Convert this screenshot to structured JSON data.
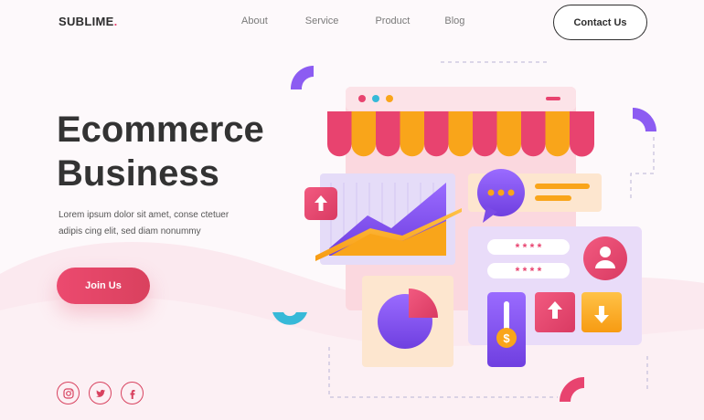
{
  "brand": {
    "name": "SUBLIME",
    "dot": ".",
    "accent": "#e8436f"
  },
  "nav": {
    "items": [
      "About",
      "Service",
      "Product",
      "Blog"
    ]
  },
  "header": {
    "contact_label": "Contact Us"
  },
  "hero": {
    "title_line1": "Ecommerce",
    "title_line2": "Business",
    "desc_line1": "Lorem ipsum dolor sit amet, conse ctetuer",
    "desc_line2": "adipis cing elit, sed diam nonummy",
    "cta_label": "Join Us"
  },
  "social": {
    "icons": [
      "instagram-icon",
      "twitter-icon",
      "facebook-icon"
    ]
  },
  "illustration": {
    "password_mask": "* * * *",
    "currency_symbol": "$",
    "colors": {
      "pink": "#e8436f",
      "orange": "#f9a51a",
      "purple": "#8c5cf2",
      "teal": "#37b9d8",
      "lavender": "#e9dcf9",
      "peach": "#fde6cf"
    }
  }
}
